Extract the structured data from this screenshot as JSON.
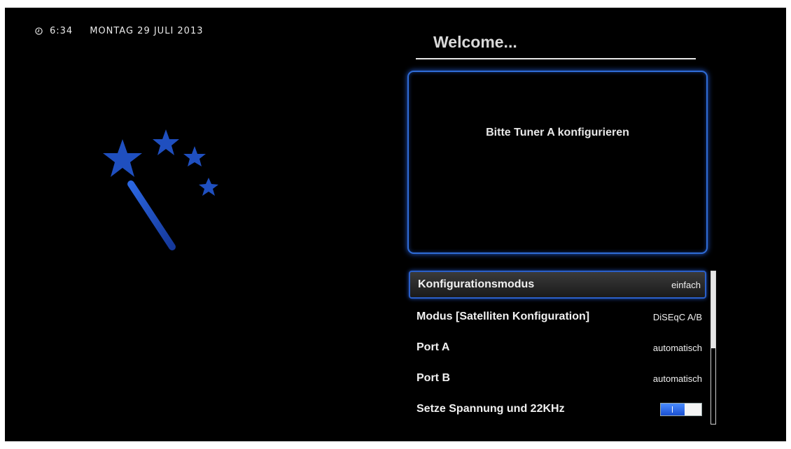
{
  "status": {
    "time": "6:34",
    "date": "MONTAG 29 JULI 2013"
  },
  "wizard": {
    "title": "Welcome...",
    "info": "Bitte Tuner A konfigurieren"
  },
  "settings": [
    {
      "label": "Konfigurationsmodus",
      "value": "einfach"
    },
    {
      "label": "Modus [Satelliten Konfiguration]",
      "value": "DiSEqC A/B"
    },
    {
      "label": "Port A",
      "value": "automatisch"
    },
    {
      "label": "Port B",
      "value": "automatisch"
    },
    {
      "label": "Setze Spannung und 22KHz",
      "value": null,
      "toggle": true
    }
  ],
  "colors": {
    "accent": "#2f6cd6",
    "star": "#1f4fbf",
    "background": "#000000"
  },
  "icons": {
    "clock": "clock-icon",
    "wand": "magic-wand-icon"
  }
}
